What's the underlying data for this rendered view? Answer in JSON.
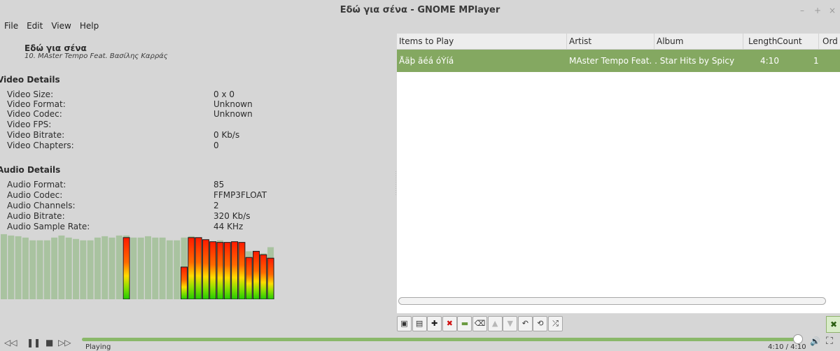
{
  "window": {
    "title": "Εδώ για σένα - GNOME MPlayer",
    "controls": [
      "–",
      "+",
      "×"
    ]
  },
  "menu": [
    "File",
    "Edit",
    "View",
    "Help"
  ],
  "now_playing": {
    "title": "Εδώ για σένα",
    "artist": "10. MAster Tempo Feat. Βασίλης Καρράς"
  },
  "video_details": {
    "heading": "Video Details",
    "rows": [
      {
        "label": "Video Size:",
        "value": "0 x 0"
      },
      {
        "label": "Video Format:",
        "value": "Unknown"
      },
      {
        "label": "Video Codec:",
        "value": "Unknown"
      },
      {
        "label": "Video FPS:",
        "value": ""
      },
      {
        "label": "Video Bitrate:",
        "value": "0 Kb/s"
      },
      {
        "label": "Video Chapters:",
        "value": "0"
      }
    ]
  },
  "audio_details": {
    "heading": "Audio Details",
    "rows": [
      {
        "label": "Audio Format:",
        "value": "85"
      },
      {
        "label": "Audio Codec:",
        "value": "FFMP3FLOAT"
      },
      {
        "label": "Audio Channels:",
        "value": "2"
      },
      {
        "label": "Audio Bitrate:",
        "value": "320 Kb/s"
      },
      {
        "label": "Audio Sample Rate:",
        "value": "44 KHz"
      }
    ]
  },
  "visualizer": {
    "levels": [
      0.95,
      0.93,
      0.92,
      0.9,
      0.86,
      0.86,
      0.86,
      0.9,
      0.93,
      0.9,
      0.88,
      0.86,
      0.86,
      0.9,
      0.92,
      0.9,
      0.93,
      0.93,
      0.9,
      0.9,
      0.92,
      0.9,
      0.9,
      0.86,
      0.86,
      0.9,
      0.92,
      0.9,
      0.86,
      0.84,
      0.86,
      0.82,
      0.79,
      0.78,
      0.7,
      0.69,
      0.67,
      0.76
    ],
    "peaks": [
      0,
      0,
      0,
      0,
      0,
      0,
      0,
      0,
      0,
      0,
      0,
      0,
      0,
      0,
      0,
      0,
      0,
      0.9,
      0,
      0,
      0,
      0,
      0,
      0,
      0,
      0.47,
      0.9,
      0.9,
      0.87,
      0.84,
      0.83,
      0.83,
      0.84,
      0.83,
      0.61,
      0.7,
      0.65,
      0.6
    ],
    "colors": {
      "ghost": "#a9c3a0",
      "bar_top": "#ff1a00",
      "bar_mid": "#ffdd00",
      "bar_low": "#22cc00"
    }
  },
  "playlist": {
    "columns": [
      "Items to Play",
      "Artist",
      "Album",
      "Length",
      "Count",
      "Ord"
    ],
    "rows": [
      {
        "item": "Åäþ ãéá óÝíá",
        "artist": "MAster Tempo Feat. . Star Hits by Spicy",
        "album": "",
        "length": "4:10",
        "count": "1"
      }
    ],
    "selection_color": "#84a861"
  },
  "toolbar": {
    "buttons": [
      {
        "name": "playlist-clear-button",
        "glyph": "▣"
      },
      {
        "name": "playlist-load-button",
        "glyph": "▤"
      },
      {
        "name": "playlist-add-button",
        "glyph": "✚"
      },
      {
        "name": "playlist-remove-button",
        "glyph": "✖"
      },
      {
        "name": "playlist-add-folder-button",
        "glyph": "▬"
      },
      {
        "name": "playlist-clear-all-button",
        "glyph": "⌫"
      },
      {
        "name": "playlist-move-up-button",
        "glyph": "▲"
      },
      {
        "name": "playlist-move-down-button",
        "glyph": "▼"
      },
      {
        "name": "playlist-undo-button",
        "glyph": "↶"
      },
      {
        "name": "playlist-repeat-button",
        "glyph": "⟲"
      },
      {
        "name": "playlist-shuffle-button",
        "glyph": "⤮"
      }
    ],
    "close_glyph": "✖"
  },
  "controls": {
    "rewind": "◁◁",
    "pause": "❚❚",
    "stop": "■",
    "forward": "▷▷",
    "status": "Playing",
    "time": "4:10 / 4:10",
    "progress": 1.0,
    "volume_glyph": "🔊",
    "fullscreen_glyph": "⛶",
    "accent": "#8ab86a"
  }
}
